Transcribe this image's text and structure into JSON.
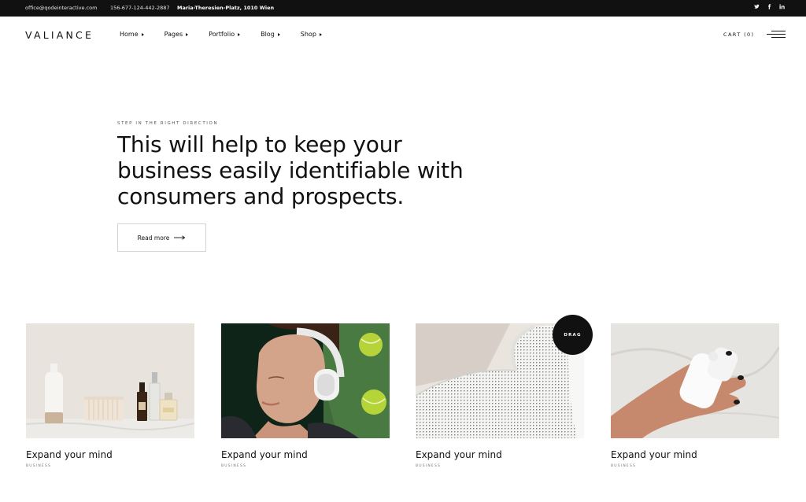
{
  "topbar": {
    "email": "office@qodeinteractive.com",
    "phone": "156-677-124-442-2887",
    "address": "Maria-Theresien-Platz, 1010 Wien",
    "social": [
      "twitter-icon",
      "facebook-icon",
      "linkedin-icon"
    ]
  },
  "header": {
    "logo": "VALIANCE",
    "nav": [
      {
        "label": "Home"
      },
      {
        "label": "Pages"
      },
      {
        "label": "Portfolio"
      },
      {
        "label": "Blog"
      },
      {
        "label": "Shop"
      }
    ],
    "cart_label": "CART (0)"
  },
  "hero": {
    "tagline": "STEP IN THE RIGHT DIRECTION",
    "headline": "This will help to keep your business easily identifiable with consumers and prospects.",
    "button_label": "Read more"
  },
  "cards": [
    {
      "title": "Expand your mind",
      "category": "BUSINESS",
      "image": "cosmetics-bottles-photo"
    },
    {
      "title": "Expand your mind",
      "category": "BUSINESS",
      "image": "woman-headphones-photo"
    },
    {
      "title": "Expand your mind",
      "category": "BUSINESS",
      "image": "open-book-photo"
    },
    {
      "title": "Expand your mind",
      "category": "BUSINESS",
      "image": "earbuds-case-photo"
    }
  ],
  "drag_label": "DRAG",
  "colors": {
    "topbar_bg": "#111111",
    "text": "#111111",
    "background": "#ffffff"
  }
}
